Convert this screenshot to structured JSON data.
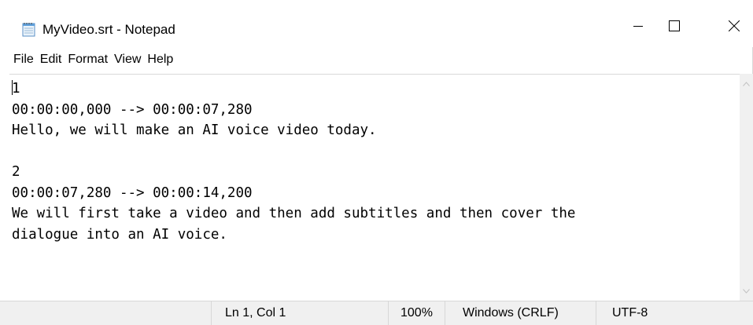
{
  "window": {
    "title": "MyVideo.srt - Notepad",
    "icon": "notepad-icon",
    "controls": [
      "minimize-icon",
      "maximize-icon",
      "close-icon"
    ]
  },
  "menu": {
    "file": "File",
    "edit": "Edit",
    "format": "Format",
    "view": "View",
    "help": "Help"
  },
  "editor": {
    "content": "1\n00:00:00,000 --> 00:00:07,280\nHello, we will make an AI voice video today.\n\n2\n00:00:07,280 --> 00:00:14,200\nWe will first take a video and then add subtitles and then cover the\ndialogue into an AI voice."
  },
  "status": {
    "position": "Ln 1, Col 1",
    "zoom": "100%",
    "line_ending": "Windows (CRLF)",
    "encoding": "UTF-8"
  }
}
